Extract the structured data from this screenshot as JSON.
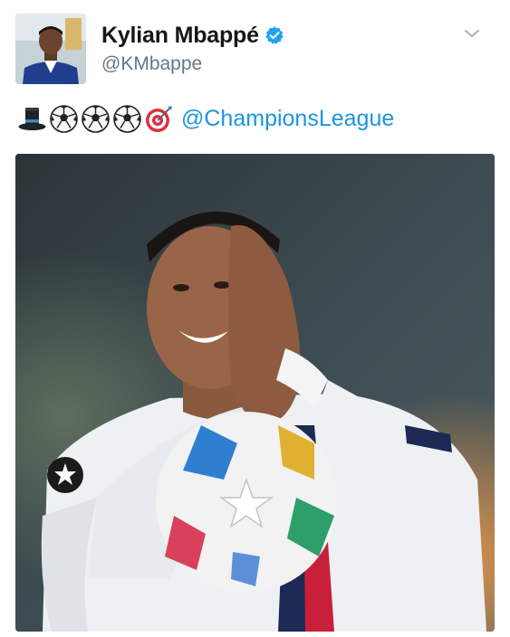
{
  "tweet": {
    "author": {
      "display_name": "Kylian Mbappé",
      "handle": "@KMbappe",
      "verified": true,
      "avatar_icon": "profile-photo"
    },
    "menu_icon": "chevron-down-icon",
    "text": {
      "emojis": [
        "top-hat",
        "soccer-ball",
        "soccer-ball",
        "soccer-ball",
        "direct-hit"
      ],
      "mention": "@ChampionsLeague"
    },
    "media": {
      "type": "photo"
    }
  },
  "colors": {
    "verified_blue": "#1da1f2",
    "mention_blue": "#1b95e0",
    "handle_gray": "#657786",
    "caret_gray": "#aab8c2"
  }
}
